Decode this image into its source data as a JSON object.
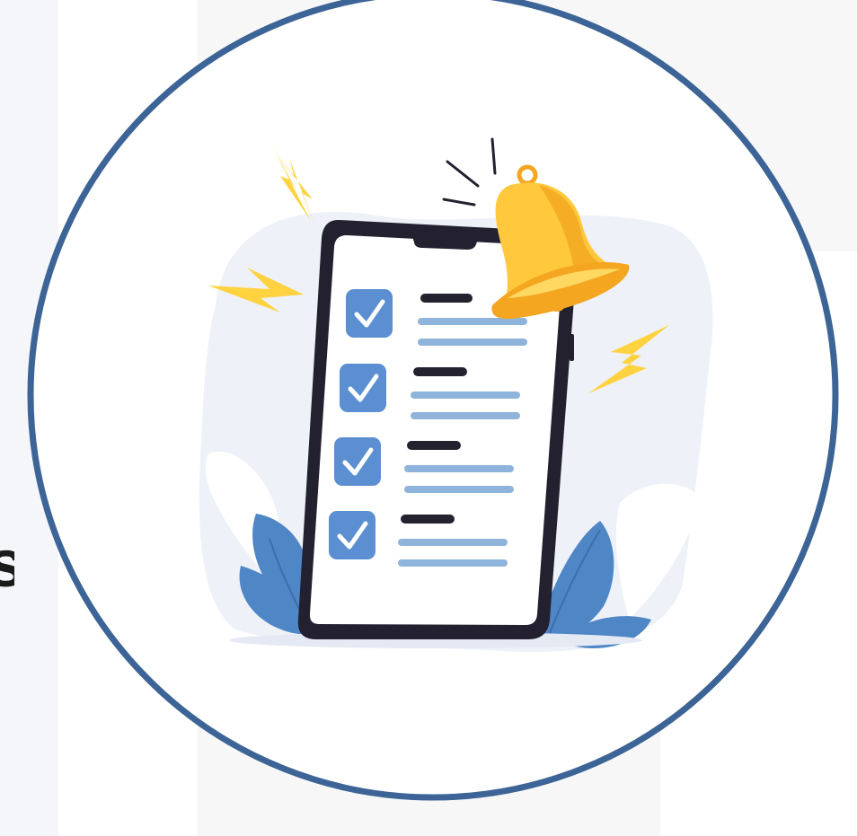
{
  "edge_text": "s",
  "colors": {
    "ring": "#3d6496",
    "phone_frame": "#23212f",
    "screen": "#ffffff",
    "check_box": "#5b8fd1",
    "check_mark": "#ffffff",
    "title_bar": "#24222f",
    "sub_line": "#8fb4dc",
    "bell": "#ffc83d",
    "bell_shade": "#f4a620",
    "bolt": "#ffd23f",
    "leaf_blue": "#4f86c6",
    "leaf_white": "#ffffff",
    "blob": "#eef1f8"
  },
  "icons": [
    "alarm-bell-icon",
    "lightning-bolt-icon",
    "check-icon",
    "leaf-icon"
  ]
}
